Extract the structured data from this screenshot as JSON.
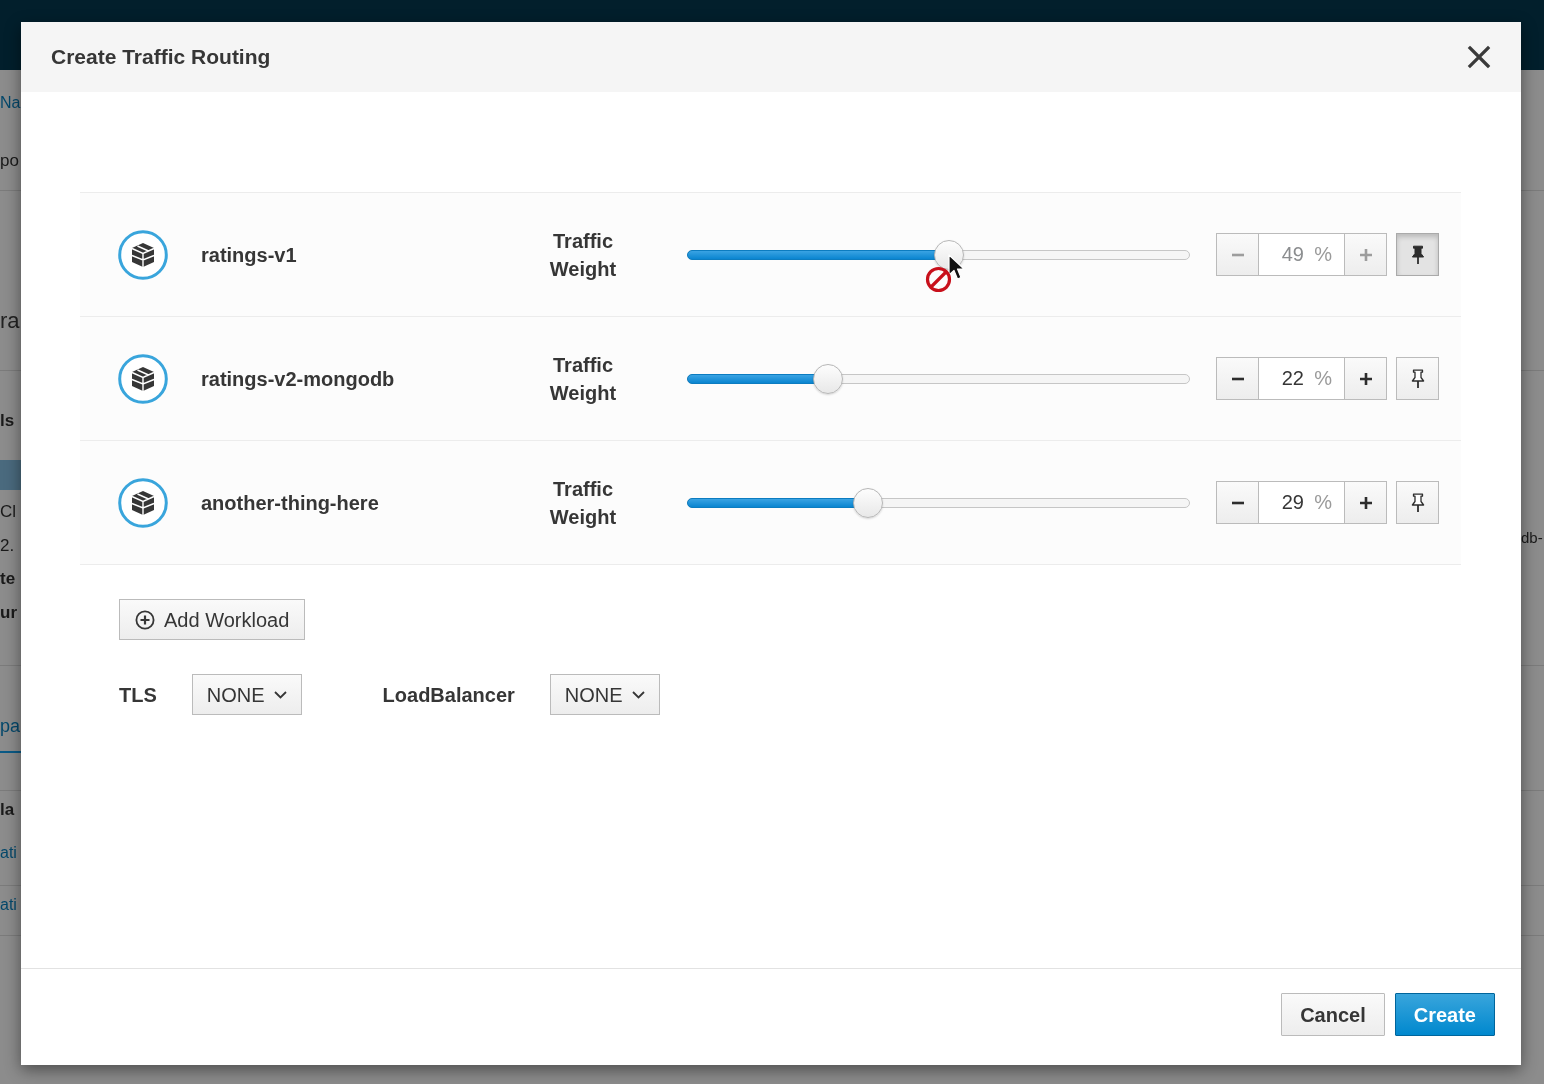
{
  "background_page": {
    "left_fragments": [
      {
        "text": "Na",
        "kind": "link"
      },
      {
        "text": "po",
        "kind": "text"
      },
      {
        "text": "ra",
        "kind": "heading"
      },
      {
        "text": "ls",
        "kind": "bold"
      },
      {
        "kind": "selected_row"
      },
      {
        "text": "Cl",
        "kind": "text"
      },
      {
        "text": "2.",
        "kind": "text"
      },
      {
        "text": "te",
        "kind": "bold"
      },
      {
        "text": "ur",
        "kind": "bold"
      },
      {
        "text": "pa",
        "kind": "tab"
      },
      {
        "text": "la",
        "kind": "bold"
      },
      {
        "text": "ati",
        "kind": "link"
      },
      {
        "text": "ati",
        "kind": "link"
      }
    ],
    "right_fragments": [
      {
        "text": "db-",
        "kind": "text"
      }
    ]
  },
  "dialog": {
    "title": "Create Traffic Routing",
    "workloads": [
      {
        "name": "ratings-v1",
        "weight_label": "Traffic Weight",
        "level": 0.52,
        "value": "49",
        "unit": "%",
        "disabled": true,
        "pinned": true
      },
      {
        "name": "ratings-v2-mongodb",
        "weight_label": "Traffic Weight",
        "level": 0.28,
        "value": "22",
        "unit": "%",
        "disabled": false,
        "pinned": false
      },
      {
        "name": "another-thing-here",
        "weight_label": "Traffic Weight",
        "level": 0.36,
        "value": "29",
        "unit": "%",
        "disabled": false,
        "pinned": false
      }
    ],
    "add_button": {
      "label": "Add Workload"
    },
    "settings": [
      {
        "label": "TLS",
        "value": "NONE"
      },
      {
        "label": "LoadBalancer",
        "value": "NONE"
      }
    ],
    "buttons": [
      {
        "label": "Cancel",
        "kind": "secondary"
      },
      {
        "label": "Create",
        "kind": "primary"
      }
    ]
  }
}
